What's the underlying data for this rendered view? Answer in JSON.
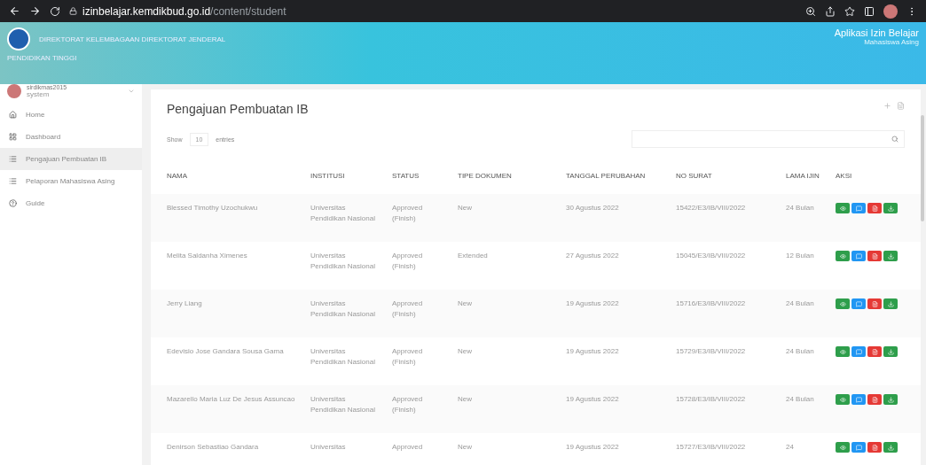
{
  "browser": {
    "url_host": "izinbelajar.kemdikbud.go.id",
    "url_path": "/content/student"
  },
  "header": {
    "org_line": "DIREKTORAT KELEMBAGAAN DIREKTORAT JENDERAL",
    "org_sub": "PENDIDIKAN TINGGI",
    "app_title": "Aplikasi Izin Belajar",
    "app_subtitle": "Mahasiswa Asing"
  },
  "user": {
    "name": "sirdikmas2015",
    "role": "system"
  },
  "sidebar": {
    "items": [
      {
        "label": "Home",
        "selected": false
      },
      {
        "label": "Dashboard",
        "selected": false
      },
      {
        "label": "Pengajuan Pembuatan IB",
        "selected": true
      },
      {
        "label": "Pelaporan Mahasiswa Asing",
        "selected": false
      },
      {
        "label": "Guide",
        "selected": false
      }
    ]
  },
  "panel": {
    "title": "Pengajuan Pembuatan IB",
    "show_label": "Show",
    "page_size": "10",
    "entries_label": "entries"
  },
  "table": {
    "columns": [
      "NAMA",
      "INSTITUSI",
      "STATUS",
      "TIPE DOKUMEN",
      "TANGGAL PERUBAHAN",
      "NO SURAT",
      "LAMA IJIN",
      "AKSI"
    ],
    "rows": [
      {
        "nama": "Blessed Timothy Uzochukwu",
        "institusi": "Universitas Pendidikan Nasional",
        "status": "Approved (Finish)",
        "tipe": "New",
        "tanggal": "30 Agustus 2022",
        "no_surat": "15422/E3/IB/VIII/2022",
        "lama": "24 Bulan"
      },
      {
        "nama": "Melita Saldanha Ximenes",
        "institusi": "Universitas Pendidikan Nasional",
        "status": "Approved (Finish)",
        "tipe": "Extended",
        "tanggal": "27 Agustus 2022",
        "no_surat": "15045/E3/IB/VIII/2022",
        "lama": "12 Bulan"
      },
      {
        "nama": "Jerry Liang",
        "institusi": "Universitas Pendidikan Nasional",
        "status": "Approved (Finish)",
        "tipe": "New",
        "tanggal": "19 Agustus 2022",
        "no_surat": "15716/E3/IB/VIII/2022",
        "lama": "24 Bulan"
      },
      {
        "nama": "Edevisio Jose Gandara Sousa Gama",
        "institusi": "Universitas Pendidikan Nasional",
        "status": "Approved (Finish)",
        "tipe": "New",
        "tanggal": "19 Agustus 2022",
        "no_surat": "15729/E3/IB/VIII/2022",
        "lama": "24 Bulan"
      },
      {
        "nama": "Mazarello Maria Luz De Jesus Assuncao",
        "institusi": "Universitas Pendidikan Nasional",
        "status": "Approved (Finish)",
        "tipe": "New",
        "tanggal": "19 Agustus 2022",
        "no_surat": "15728/E3/IB/VIII/2022",
        "lama": "24 Bulan"
      },
      {
        "nama": "Denirson Sebastiao Gandara",
        "institusi": "Universitas",
        "status": "Approved",
        "tipe": "New",
        "tanggal": "19 Agustus 2022",
        "no_surat": "15727/E3/IB/VIII/2022",
        "lama": "24"
      }
    ]
  }
}
